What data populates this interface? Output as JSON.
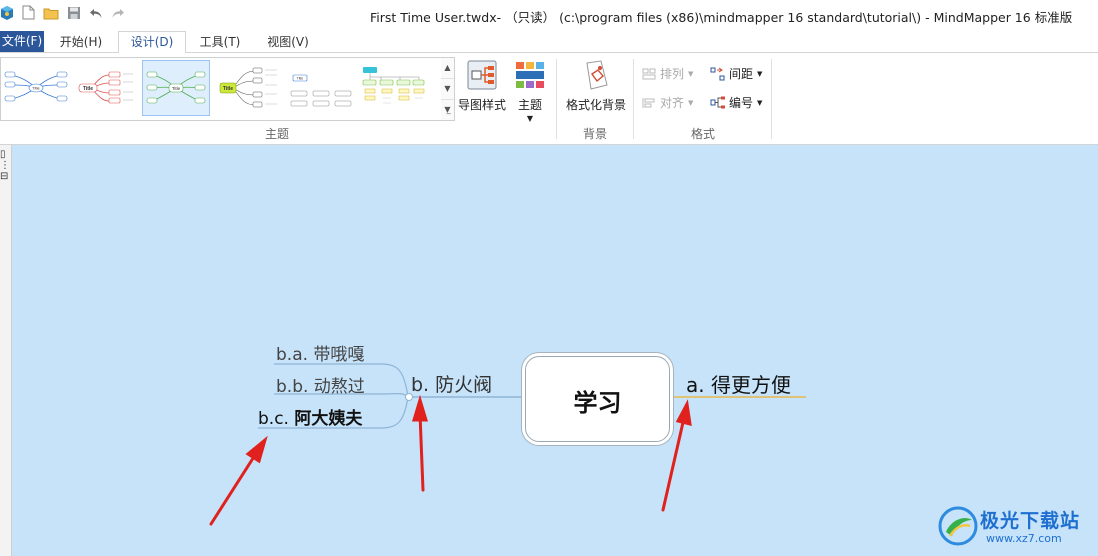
{
  "window": {
    "title": "First Time User.twdx- （只读） (c:\\program files (x86)\\mindmapper 16 standard\\tutorial\\) - MindMapper 16 标准版"
  },
  "tabs": {
    "file": "文件(F)",
    "home": "开始(H)",
    "design": "设计(D)",
    "tools": "工具(T)",
    "view": "视图(V)"
  },
  "ribbon": {
    "theme_group": {
      "label": "主题",
      "map_style_label": "导图样式",
      "theme_label": "主题",
      "thumbnails": [
        "Title",
        "Title",
        "Title",
        "Title",
        "Title"
      ]
    },
    "background_group": {
      "label": "背景",
      "format_bg_label": "格式化背景"
    },
    "format_group": {
      "label": "格式",
      "arrange_label": "排列",
      "align_label": "对齐",
      "spacing_label": "间距",
      "numbering_label": "编号"
    }
  },
  "mindmap": {
    "central": "学习",
    "right_topic": {
      "prefix": "a.",
      "text": "得更方便"
    },
    "left_topic": {
      "prefix": "b.",
      "text": "防火阀"
    },
    "subtopics": [
      {
        "prefix": "b.a.",
        "text": "带哦嘎"
      },
      {
        "prefix": "b.b.",
        "text": "动熬过"
      },
      {
        "prefix": "b.c.",
        "text": "阿大姨夫"
      }
    ]
  },
  "watermark": {
    "name": "极光下载站",
    "url": "www.xz7.com"
  },
  "colors": {
    "canvas_bg": "#c6e3f9",
    "file_tab": "#2b579a",
    "annotation_arrow": "#e0211d",
    "branch_line": "#8fb4d6",
    "right_branch_line": "#e8b84a"
  }
}
